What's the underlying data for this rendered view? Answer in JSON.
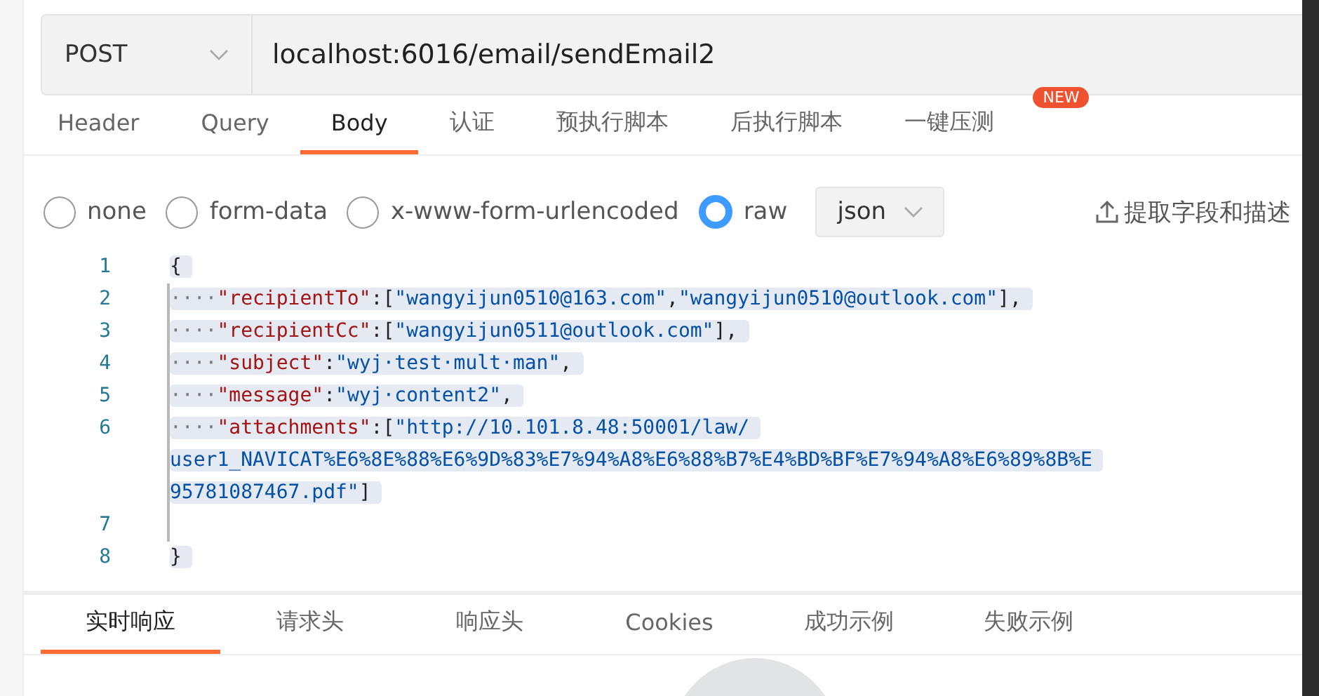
{
  "request": {
    "method": "POST",
    "url": "localhost:6016/email/sendEmail2"
  },
  "tabs": [
    {
      "label": "Header",
      "selected": false
    },
    {
      "label": "Query",
      "selected": false
    },
    {
      "label": "Body",
      "selected": true
    },
    {
      "label": "认证",
      "selected": false
    },
    {
      "label": "预执行脚本",
      "selected": false
    },
    {
      "label": "后执行脚本",
      "selected": false
    },
    {
      "label": "一键压测",
      "selected": false,
      "badge": "NEW"
    }
  ],
  "body_types": [
    {
      "label": "none",
      "selected": false
    },
    {
      "label": "form-data",
      "selected": false
    },
    {
      "label": "x-www-form-urlencoded",
      "selected": false
    },
    {
      "label": "raw",
      "selected": true
    }
  ],
  "format": "json",
  "extract_button": "提取字段和描述",
  "code_lines": [
    {
      "number": "1",
      "rows": [
        [
          {
            "kind": "punct",
            "text": "{"
          }
        ]
      ]
    },
    {
      "number": "2",
      "rows": [
        [
          {
            "kind": "ws",
            "text": "····"
          },
          {
            "kind": "key",
            "text": "\"recipientTo\""
          },
          {
            "kind": "punct",
            "text": ":["
          },
          {
            "kind": "string",
            "text": "\"wangyijun0510@163.com\""
          },
          {
            "kind": "punct",
            "text": ","
          },
          {
            "kind": "string",
            "text": "\"wangyijun0510@outlook.com\""
          },
          {
            "kind": "punct",
            "text": "],"
          }
        ]
      ]
    },
    {
      "number": "3",
      "rows": [
        [
          {
            "kind": "ws",
            "text": "····"
          },
          {
            "kind": "key",
            "text": "\"recipientCc\""
          },
          {
            "kind": "punct",
            "text": ":["
          },
          {
            "kind": "string",
            "text": "\"wangyijun0511@outlook.com\""
          },
          {
            "kind": "punct",
            "text": "],"
          }
        ]
      ]
    },
    {
      "number": "4",
      "rows": [
        [
          {
            "kind": "ws",
            "text": "····"
          },
          {
            "kind": "key",
            "text": "\"subject\""
          },
          {
            "kind": "punct",
            "text": ":"
          },
          {
            "kind": "string",
            "text": "\"wyj·test·mult·man\""
          },
          {
            "kind": "punct",
            "text": ","
          }
        ]
      ]
    },
    {
      "number": "5",
      "rows": [
        [
          {
            "kind": "ws",
            "text": "····"
          },
          {
            "kind": "key",
            "text": "\"message\""
          },
          {
            "kind": "punct",
            "text": ":"
          },
          {
            "kind": "string",
            "text": "\"wyj·content2\""
          },
          {
            "kind": "punct",
            "text": ","
          }
        ]
      ]
    },
    {
      "number": "6",
      "rows": [
        [
          {
            "kind": "ws",
            "text": "····"
          },
          {
            "kind": "key",
            "text": "\"attachments\""
          },
          {
            "kind": "punct",
            "text": ":["
          },
          {
            "kind": "string",
            "text": "\"http://10.101.8.48:50001/law/"
          }
        ],
        [
          {
            "kind": "string",
            "text": "user1_NAVICAT%E6%8E%88%E6%9D%83%E7%94%A8%E6%88%B7%E4%BD%BF%E7%94%A8%E6%89%8B%E"
          }
        ],
        [
          {
            "kind": "string",
            "text": "95781087467.pdf\""
          },
          {
            "kind": "punct",
            "text": "]"
          }
        ]
      ]
    },
    {
      "number": "7",
      "rows": [
        []
      ]
    },
    {
      "number": "8",
      "rows": [
        [
          {
            "kind": "punct",
            "text": "}"
          }
        ]
      ]
    }
  ],
  "response_tabs": [
    {
      "label": "实时响应",
      "selected": true
    },
    {
      "label": "请求头",
      "selected": false
    },
    {
      "label": "响应头",
      "selected": false
    },
    {
      "label": "Cookies",
      "selected": false
    },
    {
      "label": "成功示例",
      "selected": false
    },
    {
      "label": "失败示例",
      "selected": false
    }
  ]
}
